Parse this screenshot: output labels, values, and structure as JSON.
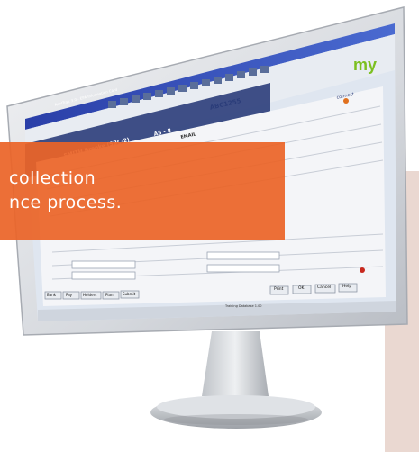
{
  "banner": {
    "line1": "collection",
    "line2": "nce process."
  },
  "screen": {
    "window_title": "RentTrak 3.0 - EPA Information Card",
    "my_logo": "my",
    "customer_header": "SMITH Brooke (SBC-2)",
    "account_code": "ABC1255",
    "unit_code": "A5 - 8",
    "brand": "connect",
    "email_tag": "EMAIL",
    "buttons": [
      "Print",
      "OK",
      "Cancel",
      "Help"
    ],
    "status_bar": [
      "Training Database 1.00"
    ],
    "tabs": [
      "Bank",
      "Pay",
      "Holders",
      "Plan",
      "Submit"
    ]
  },
  "icons": [
    "monitor-stand-icon",
    "window-close-icon"
  ]
}
